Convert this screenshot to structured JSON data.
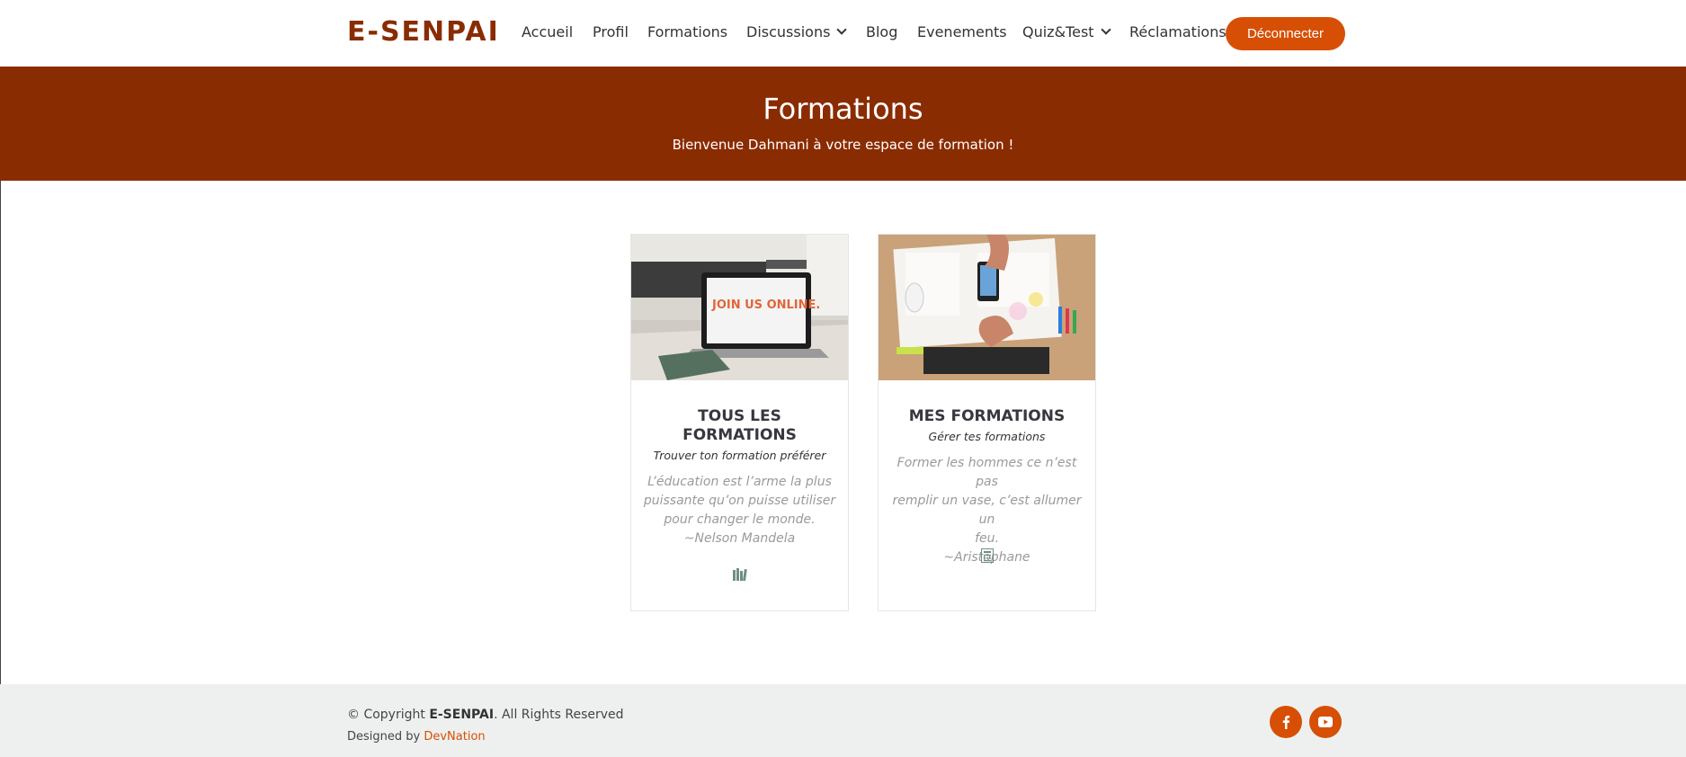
{
  "brand": {
    "name": "E-SENPAI"
  },
  "nav": {
    "items": [
      {
        "label": "Accueil"
      },
      {
        "label": "Profil"
      },
      {
        "label": "Formations"
      },
      {
        "label": "Discussions"
      },
      {
        "label": "Blog"
      },
      {
        "label": "Evenements"
      },
      {
        "label": "Quiz&Test"
      },
      {
        "label": "Réclamations"
      }
    ],
    "logout_label": "Déconnecter"
  },
  "hero": {
    "title": "Formations",
    "subtitle": "Bienvenue Dahmani à votre espace de formation !"
  },
  "cards": [
    {
      "title_line1": "TOUS LES",
      "title_line2": "FORMATIONS",
      "subtitle": "Trouver ton formation préférer",
      "quote_lines": [
        "L’éducation est l’arme la plus",
        "puissante qu’on puisse utiliser",
        "pour changer le monde.",
        "~Nelson Mandela"
      ],
      "image_text": "JOIN US ONLINE.",
      "icon": "books-icon"
    },
    {
      "title_line1": "MES FORMATIONS",
      "subtitle": "Gérer tes formations",
      "quote_lines": [
        "Former les hommes ce n’est pas",
        "remplir un vase, c’est allumer un",
        "feu.",
        "~Aristophane"
      ],
      "icon": "calculator-icon"
    }
  ],
  "footer": {
    "copyright_prefix": "© Copyright",
    "copyright_brand": "E-SENPAI",
    "copyright_suffix": ". All Rights Reserved",
    "designed_prefix": "Designed by",
    "designed_link": "DevNation"
  },
  "colors": {
    "brand": "#8a2c02",
    "accent": "#d64f05",
    "footer_bg": "#eef0ef"
  }
}
